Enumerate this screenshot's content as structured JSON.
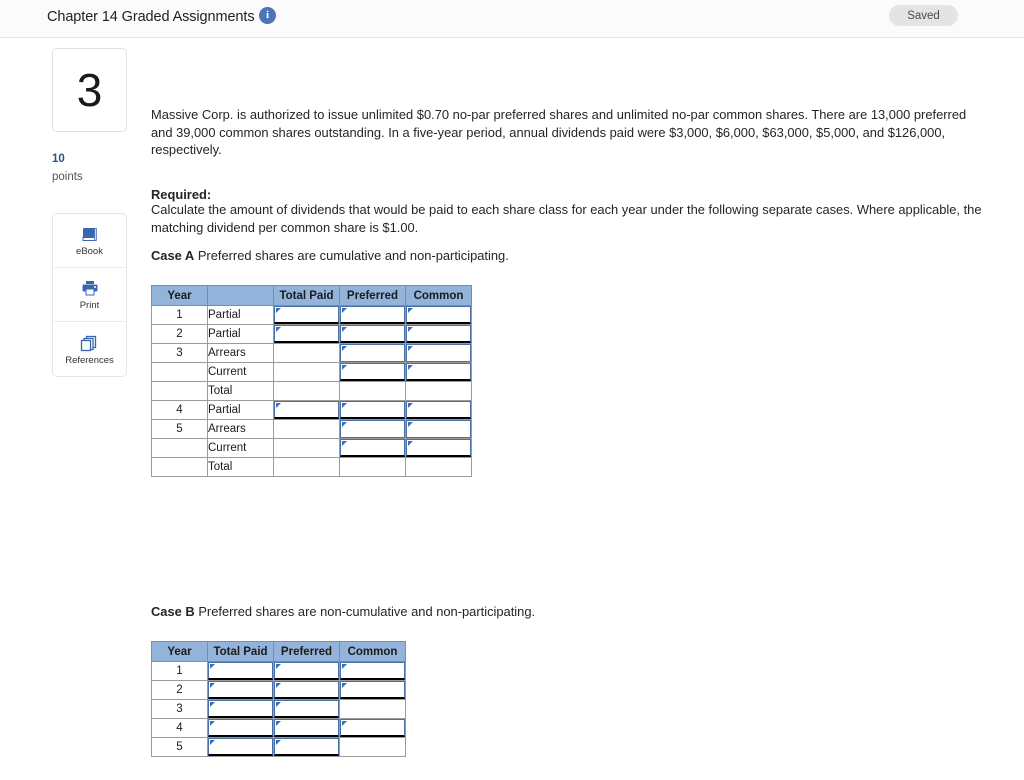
{
  "topbar": {
    "title": "Chapter 14 Graded Assignments",
    "info_icon": "info-icon",
    "saved_label": "Saved"
  },
  "question": {
    "number": "3",
    "points_value": "10",
    "points_label": "points"
  },
  "tools": [
    {
      "icon": "ebook-icon",
      "label": "eBook"
    },
    {
      "icon": "print-icon",
      "label": "Print"
    },
    {
      "icon": "references-icon",
      "label": "References"
    }
  ],
  "body": {
    "intro": "Massive Corp. is authorized to issue unlimited $0.70 no-par preferred shares and unlimited no-par common shares. There are 13,000 preferred and 39,000 common shares outstanding. In a five-year period, annual dividends paid were $3,000, $6,000, $63,000, $5,000, and $126,000, respectively.",
    "required_label": "Required:",
    "required_text": "Calculate the amount of dividends that would be paid to each share class for each year under the following separate cases. Where applicable, the matching dividend per common share is $1.00.",
    "case_a_label": "Case A",
    "case_a_text": "Preferred shares are cumulative and non-participating.",
    "case_b_label": "Case B",
    "case_b_text": "Preferred shares are non-cumulative and non-participating."
  },
  "table_a": {
    "headers": [
      "Year",
      "",
      "Total Paid",
      "Preferred",
      "Common"
    ],
    "rows": [
      {
        "year": "1",
        "label": "Partial",
        "total_paid": "",
        "preferred": "",
        "common": ""
      },
      {
        "year": "2",
        "label": "Partial",
        "total_paid": "",
        "preferred": "",
        "common": ""
      },
      {
        "year": "3",
        "label": "Arrears",
        "total_paid": "",
        "preferred": "",
        "common": ""
      },
      {
        "year": "",
        "label": "Current",
        "total_paid": "",
        "preferred": "",
        "common": ""
      },
      {
        "year": "",
        "label": "Total",
        "total_paid": "",
        "preferred": "",
        "common": ""
      },
      {
        "year": "4",
        "label": "Partial",
        "total_paid": "",
        "preferred": "",
        "common": ""
      },
      {
        "year": "5",
        "label": "Arrears",
        "total_paid": "",
        "preferred": "",
        "common": ""
      },
      {
        "year": "",
        "label": "Current",
        "total_paid": "",
        "preferred": "",
        "common": ""
      },
      {
        "year": "",
        "label": "Total",
        "total_paid": "",
        "preferred": "",
        "common": ""
      }
    ]
  },
  "table_b": {
    "headers": [
      "Year",
      "Total Paid",
      "Preferred",
      "Common"
    ],
    "rows": [
      {
        "year": "1",
        "total_paid": "",
        "preferred": "",
        "common": ""
      },
      {
        "year": "2",
        "total_paid": "",
        "preferred": "",
        "common": ""
      },
      {
        "year": "3",
        "total_paid": "",
        "preferred": "",
        "common": ""
      },
      {
        "year": "4",
        "total_paid": "",
        "preferred": "",
        "common": ""
      },
      {
        "year": "5",
        "total_paid": "",
        "preferred": "",
        "common": ""
      }
    ]
  },
  "colors": {
    "header_blue": "#93b3da",
    "accent_blue": "#3a6fbd",
    "points_blue": "#2c5282",
    "saved_bg": "#e4e4e4"
  }
}
